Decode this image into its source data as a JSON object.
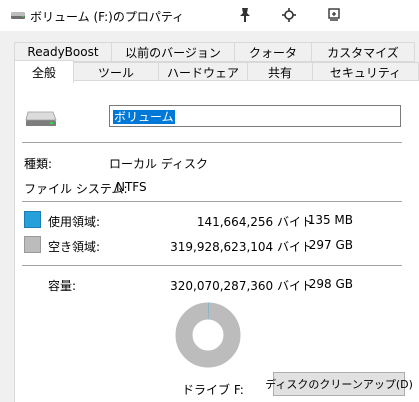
{
  "window": {
    "title": "ボリューム (F:)のプロパティ",
    "controls": [
      "pin-icon",
      "move-icon",
      "restore-icon"
    ]
  },
  "tabs_back": [
    "ReadyBoost",
    "以前のバージョン",
    "クォータ",
    "カスタマイズ"
  ],
  "tabs_front": [
    "全般",
    "ツール",
    "ハードウェア",
    "共有",
    "セキュリティ"
  ],
  "active_tab": "全般",
  "general": {
    "volume_name": "ボリューム",
    "type_label": "種類:",
    "type_value": "ローカル ディスク",
    "fs_label": "ファイル システム:",
    "fs_value": "NTFS",
    "used_label": "使用領域:",
    "used_bytes": "141,664,256 バイト",
    "used_size": "135 MB",
    "used_color": "#26a0da",
    "free_label": "空き領域:",
    "free_bytes": "319,928,623,104 バイト",
    "free_size": "297 GB",
    "free_color": "#bcbcbc",
    "capacity_label": "容量:",
    "capacity_bytes": "320,070,287,360 バイト",
    "capacity_size": "298 GB",
    "used_fraction": 0.00044,
    "drive_label": "ドライブ F:",
    "cleanup_button": "ディスクのクリーンアップ(D)"
  }
}
